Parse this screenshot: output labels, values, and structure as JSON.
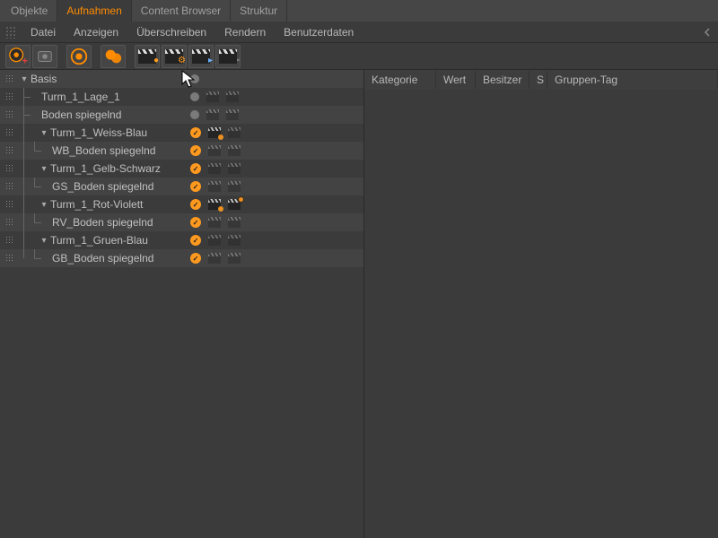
{
  "tabs": [
    {
      "label": "Objekte",
      "active": false
    },
    {
      "label": "Aufnahmen",
      "active": true
    },
    {
      "label": "Content Browser",
      "active": false
    },
    {
      "label": "Struktur",
      "active": false
    }
  ],
  "menu": {
    "items": [
      "Datei",
      "Anzeigen",
      "Überschreiben",
      "Rendern",
      "Benutzerdaten"
    ]
  },
  "toolbar": {
    "buttons": [
      "take-add",
      "take-option",
      "take-main",
      "take-auto",
      "clapper-1",
      "clapper-2",
      "clapper-3",
      "clapper-4"
    ]
  },
  "attr_columns": [
    "Kategorie",
    "Wert",
    "Besitzer",
    "S",
    "Gruppen-Tag"
  ],
  "tree": [
    {
      "label": "Basis",
      "level": 0,
      "expanded": true,
      "hasHandle": true,
      "status": "dot",
      "clap": false
    },
    {
      "label": "Turm_1_Lage_1",
      "level": 1,
      "expanded": false,
      "status": "dot",
      "clap": true,
      "faded": true
    },
    {
      "label": "Boden spiegelnd",
      "level": 1,
      "expanded": false,
      "status": "dot",
      "clap": true,
      "faded": true
    },
    {
      "label": "Turm_1_Weiss-Blau",
      "level": 1,
      "expanded": true,
      "status": "check",
      "clap": true,
      "cam": true
    },
    {
      "label": "WB_Boden spiegelnd",
      "level": 2,
      "corner": true,
      "status": "check",
      "clap": true,
      "faded": true
    },
    {
      "label": "Turm_1_Gelb-Schwarz",
      "level": 1,
      "expanded": true,
      "status": "check",
      "clap": true,
      "faded": true
    },
    {
      "label": "GS_Boden spiegelnd",
      "level": 2,
      "corner": true,
      "status": "check",
      "clap": true,
      "faded": true
    },
    {
      "label": "Turm_1_Rot-Violett",
      "level": 1,
      "expanded": true,
      "status": "check",
      "clap": true,
      "cam": true,
      "gear": true
    },
    {
      "label": "RV_Boden spiegelnd",
      "level": 2,
      "corner": true,
      "status": "check",
      "clap": true,
      "faded": true
    },
    {
      "label": "Turm_1_Gruen-Blau",
      "level": 1,
      "expanded": true,
      "status": "check",
      "clap": true,
      "faded": true
    },
    {
      "label": "GB_Boden spiegelnd",
      "level": 2,
      "corner": true,
      "status": "check",
      "clap": true,
      "faded": true
    }
  ]
}
